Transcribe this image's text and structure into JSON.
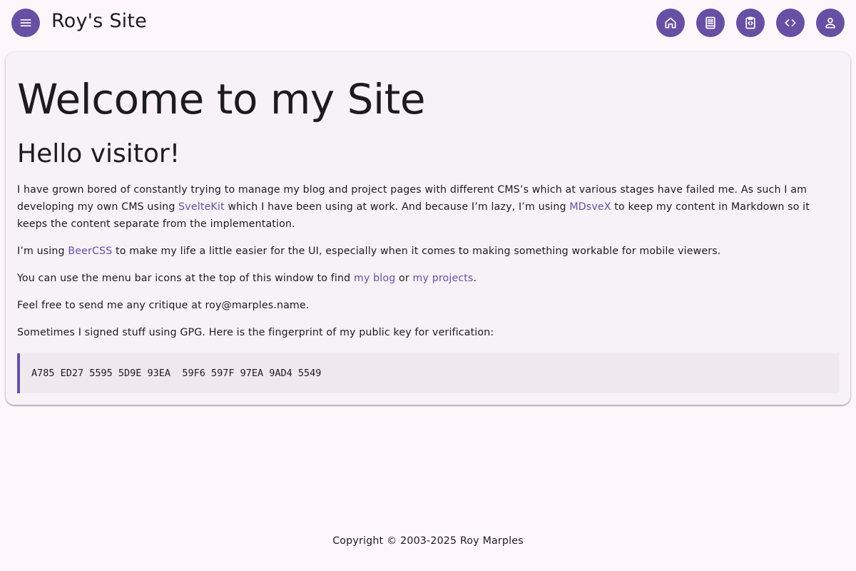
{
  "header": {
    "title": "Roy's Site",
    "menu_icon": "menu-icon",
    "nav": [
      {
        "name": "home",
        "icon": "home-icon"
      },
      {
        "name": "blog",
        "icon": "book-icon"
      },
      {
        "name": "projects",
        "icon": "clipboard-code-icon"
      },
      {
        "name": "code",
        "icon": "code-icon"
      },
      {
        "name": "about",
        "icon": "person-icon"
      }
    ]
  },
  "main": {
    "heading": "Welcome to my Site",
    "subheading": "Hello visitor!",
    "p1": {
      "t1": "I have grown bored of constantly trying to manage my blog and project pages with different CMS’s which at various stages have failed me. As such I am developing my own CMS using ",
      "link1": "SvelteKit",
      "t2": " which I have been using at work. And because I’m lazy, I’m using ",
      "link2": "MDsveX",
      "t3": " to keep my content in Markdown so it keeps the content separate from the implementation."
    },
    "p2": {
      "t1": "I’m using ",
      "link1": "BeerCSS",
      "t2": " to make my life a little easier for the UI, especially when it comes to making something workable for mobile viewers."
    },
    "p3": {
      "t1": "You can use the menu bar icons at the top of this window to find ",
      "link1": "my blog",
      "t2": " or ",
      "link2": "my projects",
      "t3": "."
    },
    "p4": "Feel free to send me any critique at roy@marples.name.",
    "p5": "Sometimes I signed stuff using GPG. Here is the fingerprint of my public key for verification:",
    "fingerprint": "A785 ED27 5595 5D9E 93EA  59F6 597F 97EA 9AD4 5549"
  },
  "footer": {
    "copyright": "Copyright © 2003-2025 Roy Marples"
  },
  "colors": {
    "accent": "#6750a4",
    "background": "#fdf7fb",
    "card": "#f7f2f7"
  }
}
